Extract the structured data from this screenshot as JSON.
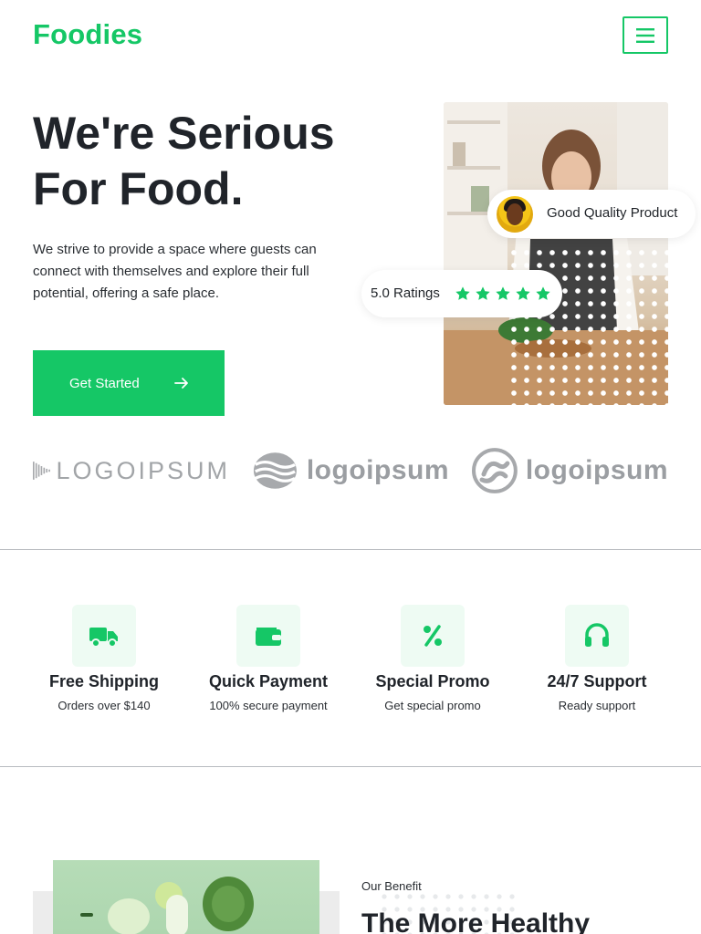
{
  "header": {
    "brand": "Foodies",
    "menu_icon": "hamburger-menu-icon"
  },
  "hero": {
    "title_line1": "We're Serious",
    "title_line2": "For Food.",
    "description": "We strive to provide a space where guests can connect with themselves and explore their full potential, offering a safe place.",
    "cta_label": "Get Started",
    "cta_icon": "arrow-right-icon",
    "badge_quality_label": "Good Quality Product",
    "rating_label": "5.0 Ratings",
    "rating_stars": 5,
    "star_color": "#15c766"
  },
  "logos": [
    "logoipsum-wave-logo",
    "logoipsum-stack-logo",
    "logoipsum-swirl-logo"
  ],
  "logo_texts": [
    "LOGOIPSUM",
    "logoipsum",
    "logoipsum"
  ],
  "features": [
    {
      "icon": "truck-icon",
      "title": "Free Shipping",
      "subtitle": "Orders over $140"
    },
    {
      "icon": "wallet-icon",
      "title": "Quick Payment",
      "subtitle": "100% secure payment"
    },
    {
      "icon": "percent-icon",
      "title": "Special Promo",
      "subtitle": "Get special promo"
    },
    {
      "icon": "headphones-icon",
      "title": "24/7 Support",
      "subtitle": "Ready support"
    }
  ],
  "benefit": {
    "eyebrow": "Our Benefit",
    "title": "The More Healthy"
  },
  "colors": {
    "accent": "#15c766",
    "accent_soft": "#eefbf3",
    "text": "#20242a"
  }
}
